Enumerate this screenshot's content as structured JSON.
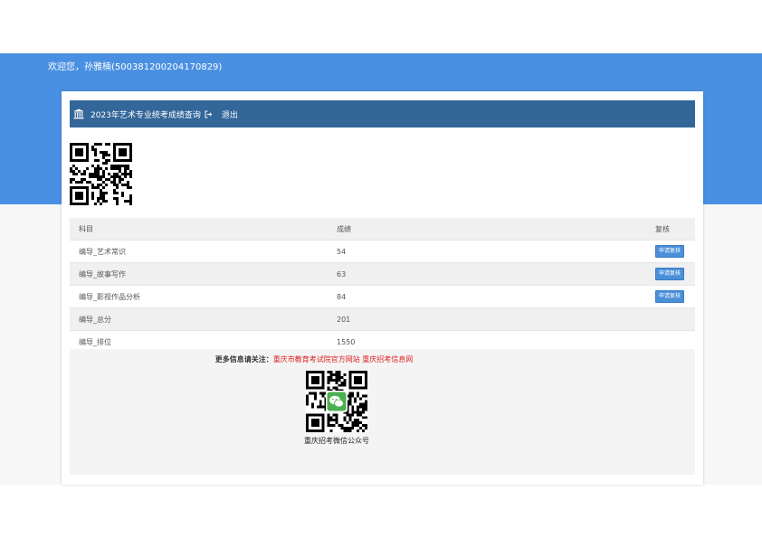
{
  "header": {
    "welcome_text": "欢迎您，孙雅楠(500381200204170829)"
  },
  "titlebar": {
    "title": "2023年艺术专业统考成绩查询",
    "exit_label": "退出",
    "bank_icon": "institution-icon",
    "exit_icon": "sign-out-icon"
  },
  "table": {
    "headers": {
      "subject": "科目",
      "score": "成绩",
      "review": "复核"
    },
    "rows": [
      {
        "subject": "编导_艺术常识",
        "score": "54",
        "action": "申请复核"
      },
      {
        "subject": "编导_故事写作",
        "score": "63",
        "action": "申请复核"
      },
      {
        "subject": "编导_影视作品分析",
        "score": "84",
        "action": "申请复核"
      },
      {
        "subject": "编导_总分",
        "score": "201",
        "action": ""
      },
      {
        "subject": "编导_排位",
        "score": "1550",
        "action": ""
      }
    ]
  },
  "info": {
    "more_label": "更多信息请关注：",
    "link1": "重庆市教育考试院官方网站",
    "link2": "重庆招考信息网",
    "wechat_caption": "重庆招考微信公众号"
  },
  "colors": {
    "header_blue": "#4a90e2",
    "titlebar_blue": "#336699",
    "button_blue": "#4a8fd8",
    "link_red": "#e02020"
  }
}
